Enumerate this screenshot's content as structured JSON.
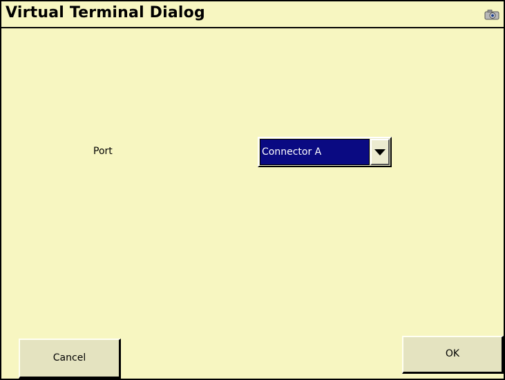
{
  "window": {
    "title": "Virtual Terminal Dialog",
    "title_icon": "camera-icon",
    "background_color": "#f7f6c1"
  },
  "form": {
    "port_label": "Port",
    "port_select": {
      "selected": "Connector A",
      "selected_bg": "#0a0a82"
    }
  },
  "buttons": {
    "cancel_label": "Cancel",
    "ok_label": "OK"
  }
}
